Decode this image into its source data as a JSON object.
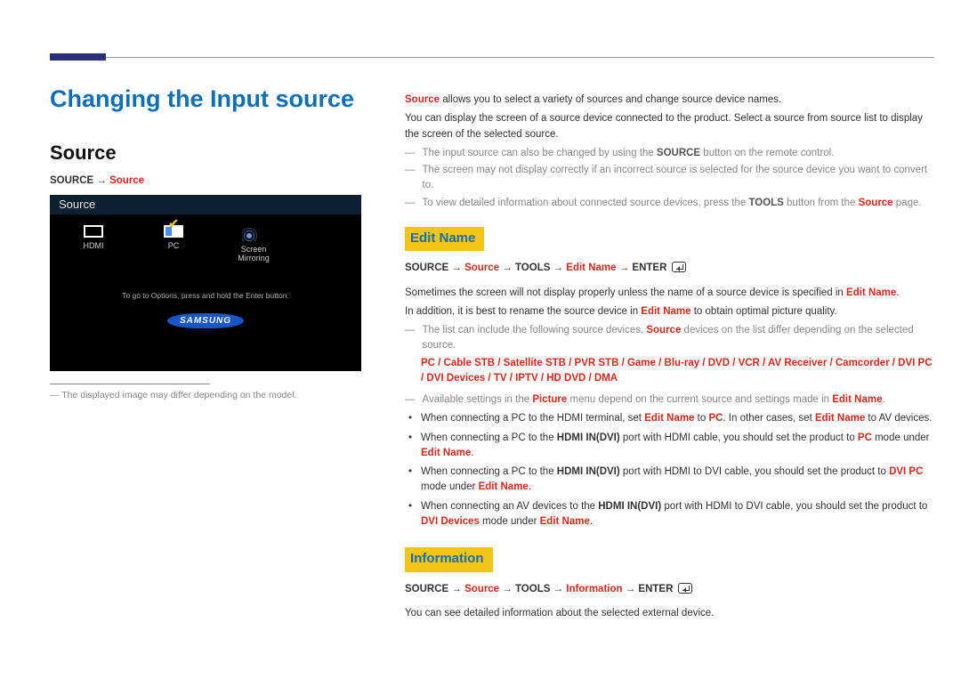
{
  "chapter_title": "Changing the Input source",
  "section_title": "Source",
  "nav_source": {
    "prefix": "SOURCE → ",
    "link": "Source"
  },
  "tv": {
    "header": "Source",
    "items": [
      {
        "label": "HDMI",
        "checked": false
      },
      {
        "label": "PC",
        "checked": true
      },
      {
        "label": "Screen Mirroring",
        "checked": false
      }
    ],
    "hint": "To go to Options, press and hold the Enter button.",
    "logo": "SAMSUNG"
  },
  "left_note": "The displayed image may differ depending on the model.",
  "right": {
    "p1_a": "Source",
    "p1_b": " allows you to select a variety of sources and change source device names.",
    "p2": "You can display the screen of a source device connected to the product. Select a source from source list to display the screen of the selected source.",
    "note1_a": "The input source can also be changed by using the ",
    "note1_b": "SOURCE",
    "note1_c": " button on the remote control.",
    "note2": "The screen may not display correctly if an incorrect source is selected for the source device you want to convert to.",
    "note3_a": "To view detailed information about connected source devices, press the ",
    "note3_b": "TOOLS",
    "note3_c": " button from the ",
    "note3_d": "Source",
    "note3_e": " page.",
    "edit_name": {
      "heading": "Edit Name",
      "nav": {
        "a": "SOURCE → ",
        "b": "Source",
        "c": " → TOOLS → ",
        "d": "Edit Name",
        "e": " → ENTER "
      },
      "p1_a": "Sometimes the screen will not display properly unless the name of a source device is specified in ",
      "p1_b": "Edit Name",
      "p1_c": ".",
      "p2_a": "In addition, it is best to rename the source device in ",
      "p2_b": "Edit Name",
      "p2_c": " to obtain optimal picture quality.",
      "note1_a": "The list can include the following source devices. ",
      "note1_b": "Source",
      "note1_c": " devices on the list differ depending on the selected source.",
      "devices": "PC / Cable STB / Satellite STB / PVR STB / Game / Blu-ray / DVD / VCR / AV Receiver / Camcorder / DVI PC / DVI Devices / TV / IPTV / HD DVD / DMA",
      "note2_a": "Available settings in the ",
      "note2_b": "Picture",
      "note2_c": " menu depend on the current source and settings made in ",
      "note2_d": "Edit Name",
      "note2_e": ".",
      "b1_a": "When connecting a PC to the HDMI terminal, set ",
      "b1_b": "Edit Name",
      "b1_c": " to ",
      "b1_d": "PC",
      "b1_e": ". In other cases, set ",
      "b1_f": "Edit Name",
      "b1_g": " to AV devices.",
      "b2_a": "When connecting a PC to the ",
      "b2_b": "HDMI IN(DVI)",
      "b2_c": " port with HDMI cable, you should set the product to ",
      "b2_d": "PC",
      "b2_e": " mode under ",
      "b2_f": "Edit Name",
      "b2_g": ".",
      "b3_a": "When connecting a PC to the ",
      "b3_b": "HDMI IN(DVI)",
      "b3_c": " port with HDMI to DVI cable, you should set the product to ",
      "b3_d": "DVI PC",
      "b3_e": " mode under ",
      "b3_f": "Edit Name",
      "b3_g": ".",
      "b4_a": "When connecting an AV devices to the ",
      "b4_b": "HDMI IN(DVI)",
      "b4_c": " port with HDMI to DVI cable, you should set the product to ",
      "b4_d": "DVI Devices",
      "b4_e": " mode under ",
      "b4_f": "Edit Name",
      "b4_g": "."
    },
    "information": {
      "heading": "Information",
      "nav": {
        "a": "SOURCE → ",
        "b": "Source",
        "c": " → TOOLS → ",
        "d": "Information",
        "e": " → ENTER "
      },
      "p1": "You can see detailed information about the selected external device."
    }
  }
}
